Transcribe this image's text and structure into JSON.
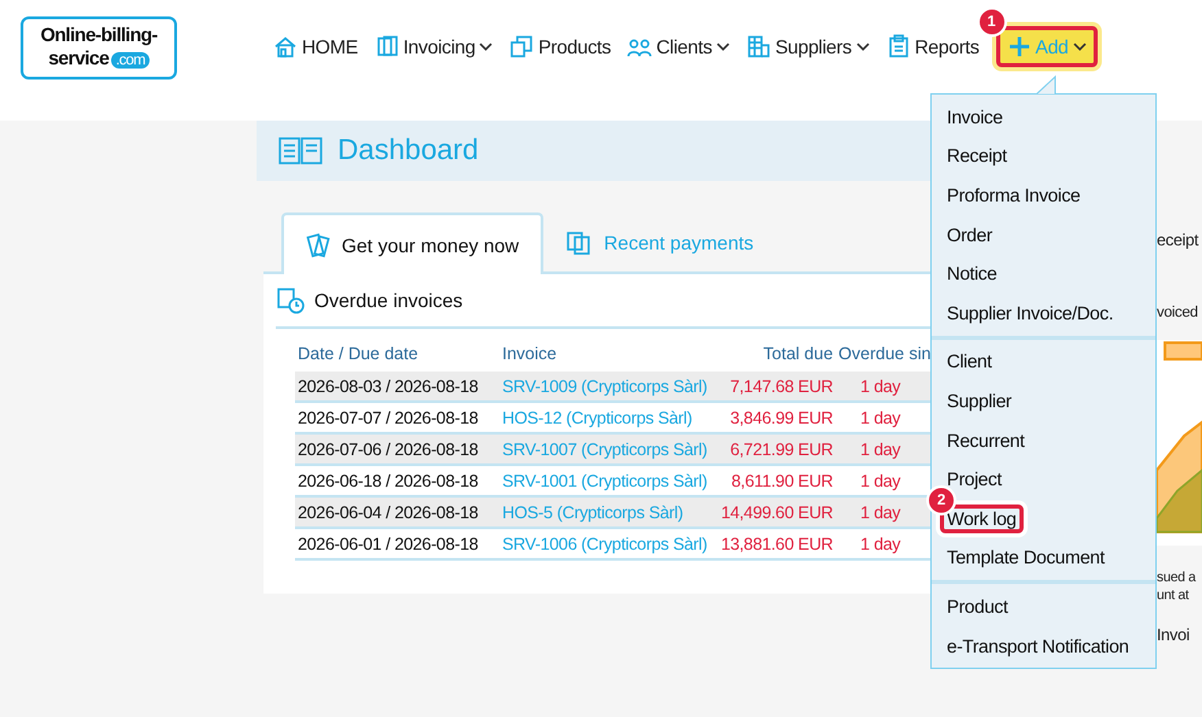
{
  "logo": {
    "line_1": "Online-billing-",
    "line_2": "service",
    "badge": ".com"
  },
  "nav": [
    {
      "label": "HOME",
      "dropdown": false,
      "selected": false
    },
    {
      "label": "Invoicing",
      "dropdown": true,
      "selected": false
    },
    {
      "label": "Products",
      "dropdown": false,
      "selected": false
    },
    {
      "label": "Clients",
      "dropdown": true,
      "selected": false
    },
    {
      "label": "Suppliers",
      "dropdown": true,
      "selected": false
    },
    {
      "label": "Reports",
      "dropdown": false,
      "selected": false
    },
    {
      "label": "Add",
      "dropdown": true,
      "selected": true,
      "step": "1"
    }
  ],
  "page_title": "Dashboard",
  "tabs": [
    {
      "label": "Get your money now",
      "selected": true
    },
    {
      "label": "Recent payments",
      "selected": false
    }
  ],
  "section_title": "Overdue invoices",
  "table": {
    "columns": [
      "Date / Due date",
      "Invoice",
      "Total due",
      "Overdue sin"
    ],
    "rows": [
      {
        "dates": "2026-08-03 / 2026-08-18",
        "invoice": "SRV-1009 (Crypticorps Sàrl)",
        "total": "7,147.68 EUR",
        "overdue": "1 day"
      },
      {
        "dates": "2026-07-07 / 2026-08-18",
        "invoice": "HOS-12 (Crypticorps Sàrl)",
        "total": "3,846.99 EUR",
        "overdue": "1 day"
      },
      {
        "dates": "2026-07-06 / 2026-08-18",
        "invoice": "SRV-1007 (Crypticorps Sàrl)",
        "total": "6,721.99 EUR",
        "overdue": "1 day"
      },
      {
        "dates": "2026-06-18 / 2026-08-18",
        "invoice": "SRV-1001 (Crypticorps Sàrl)",
        "total": "8,611.90 EUR",
        "overdue": "1 day"
      },
      {
        "dates": "2026-06-04 / 2026-08-18",
        "invoice": "HOS-5 (Crypticorps Sàrl)",
        "total": "14,499.60 EUR",
        "overdue": "1 day"
      },
      {
        "dates": "2026-06-01 / 2026-08-18",
        "invoice": "SRV-1006 (Crypticorps Sàrl)",
        "total": "13,881.60 EUR",
        "overdue": "1 day"
      }
    ]
  },
  "add_menu": {
    "groups": [
      [
        {
          "label": "Invoice",
          "highlighted": false
        },
        {
          "label": "Receipt",
          "highlighted": false
        },
        {
          "label": "Proforma Invoice",
          "highlighted": false
        },
        {
          "label": "Order",
          "highlighted": false
        },
        {
          "label": "Notice",
          "highlighted": false
        },
        {
          "label": "Supplier Invoice/Doc.",
          "highlighted": false
        }
      ],
      [
        {
          "label": "Client",
          "highlighted": false
        },
        {
          "label": "Supplier",
          "highlighted": false
        },
        {
          "label": "Recurrent",
          "highlighted": false
        },
        {
          "label": "Project",
          "highlighted": false
        },
        {
          "label": "Work log",
          "highlighted": true,
          "step": "2"
        },
        {
          "label": "Template Document",
          "highlighted": false
        }
      ],
      [
        {
          "label": "Product",
          "highlighted": false
        },
        {
          "label": "e-Transport Notification",
          "highlighted": false
        }
      ]
    ]
  },
  "right_panel": {
    "tab_fragment": "eceipt",
    "subtitle_fragment": "voiced",
    "note_fragments": [
      "sued a",
      "unt at"
    ],
    "footer_fragment": "Invoi"
  }
}
